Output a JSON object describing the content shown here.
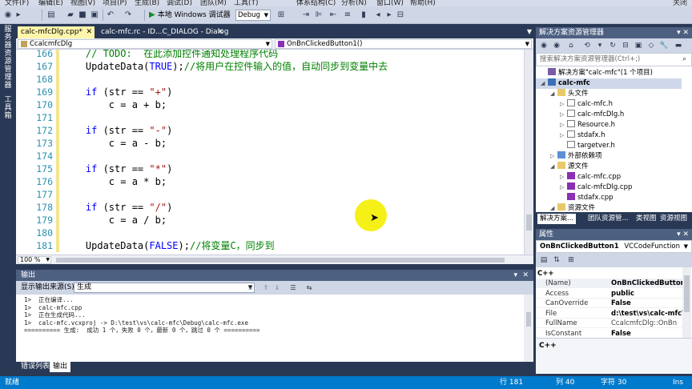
{
  "menubar": {
    "items": [
      "文件(F)",
      "编辑(E)",
      "视图(V)",
      "项目(P)",
      "生成(B)",
      "调试(D)",
      "团队(M)",
      "工具(T)",
      "体系结构(C)",
      "分析(N)",
      "窗口(W)",
      "帮助(H)"
    ],
    "close": "关闭"
  },
  "toolbar": {
    "run_label": "本地 Windows 调试器",
    "config_value": "Debug"
  },
  "left_rail": {
    "tab1": "服务器资源管理器",
    "tab2": "工具箱"
  },
  "doc_tabs": {
    "active_label": "calc-mfcDlg.cpp*",
    "inactive_label": "calc-mfc.rc - ID...C_DIALOG - Dialog"
  },
  "navbar": {
    "class_value": "CcalcmfcDlg",
    "member_value": "OnBnClickedButton1()"
  },
  "editor": {
    "lines": [
      {
        "num": "166",
        "tokens": [
          {
            "t": "    // TODO:  在此添加控件通知处理程序代码",
            "c": "cm"
          }
        ]
      },
      {
        "num": "167",
        "tokens": [
          {
            "t": "    UpdateData(",
            "c": ""
          },
          {
            "t": "TRUE",
            "c": "kw"
          },
          {
            "t": ");",
            "c": ""
          },
          {
            "t": "//将用户在控件输入的值，自动同步到变量中去",
            "c": "cm"
          }
        ]
      },
      {
        "num": "168",
        "tokens": []
      },
      {
        "num": "169",
        "tokens": [
          {
            "t": "    ",
            "c": ""
          },
          {
            "t": "if",
            "c": "kw"
          },
          {
            "t": " (str == ",
            "c": ""
          },
          {
            "t": "\"+\"",
            "c": "str"
          },
          {
            "t": ")",
            "c": ""
          }
        ]
      },
      {
        "num": "170",
        "tokens": [
          {
            "t": "        c = a + b;",
            "c": ""
          }
        ]
      },
      {
        "num": "171",
        "tokens": []
      },
      {
        "num": "172",
        "tokens": [
          {
            "t": "    ",
            "c": ""
          },
          {
            "t": "if",
            "c": "kw"
          },
          {
            "t": " (str == ",
            "c": ""
          },
          {
            "t": "\"-\"",
            "c": "str"
          },
          {
            "t": ")",
            "c": ""
          }
        ]
      },
      {
        "num": "173",
        "tokens": [
          {
            "t": "        c = a - b;",
            "c": ""
          }
        ]
      },
      {
        "num": "174",
        "tokens": []
      },
      {
        "num": "175",
        "tokens": [
          {
            "t": "    ",
            "c": ""
          },
          {
            "t": "if",
            "c": "kw"
          },
          {
            "t": " (str == ",
            "c": ""
          },
          {
            "t": "\"*\"",
            "c": "str"
          },
          {
            "t": ")",
            "c": ""
          }
        ]
      },
      {
        "num": "176",
        "tokens": [
          {
            "t": "        c = a * b;",
            "c": ""
          }
        ]
      },
      {
        "num": "177",
        "tokens": []
      },
      {
        "num": "178",
        "tokens": [
          {
            "t": "    ",
            "c": ""
          },
          {
            "t": "if",
            "c": "kw"
          },
          {
            "t": " (str == ",
            "c": ""
          },
          {
            "t": "\"/\"",
            "c": "str"
          },
          {
            "t": ")",
            "c": ""
          }
        ]
      },
      {
        "num": "179",
        "tokens": [
          {
            "t": "        c = a / b;",
            "c": ""
          }
        ]
      },
      {
        "num": "180",
        "tokens": []
      },
      {
        "num": "181",
        "tokens": [
          {
            "t": "    UpdateData(",
            "c": ""
          },
          {
            "t": "FALSE",
            "c": "kw"
          },
          {
            "t": ");",
            "c": ""
          },
          {
            "t": "//将变量C，同步到",
            "c": "cm"
          }
        ]
      }
    ],
    "zoom": "100 %"
  },
  "output": {
    "title": "输出",
    "source_label": "显示输出来源(S):",
    "source_value": "生成",
    "lines": [
      "1>  正在编译...",
      "1>  calc-mfc.cpp",
      "1>  正在生成代码...",
      "1>  calc-mfc.vcxproj -> D:\\test\\vs\\calc-mfc\\Debug\\calc-mfc.exe",
      "========== 生成:  成功 1 个，失败 0 个，最新 0 个，跳过 0 个 =========="
    ]
  },
  "bottom_tabs": {
    "errors": "错误列表",
    "output": "输出"
  },
  "solution_explorer": {
    "title": "解决方案资源管理器",
    "search_placeholder": "搜索解决方案资源管理器(Ctrl+;)",
    "tree": [
      {
        "label": "解决方案\"calc-mfc\"(1 个项目)",
        "icon": "solution-icon",
        "expander": "",
        "indent": 0,
        "bold": false
      },
      {
        "label": "calc-mfc",
        "icon": "project-icon",
        "expander": "◢",
        "indent": 0,
        "bold": true,
        "selected": true
      },
      {
        "label": "头文件",
        "icon": "folder-icon",
        "expander": "◢",
        "indent": 1,
        "bold": false
      },
      {
        "label": "calc-mfc.h",
        "icon": "file-icon",
        "expander": "▷",
        "indent": 2,
        "bold": false
      },
      {
        "label": "calc-mfcDlg.h",
        "icon": "file-icon",
        "expander": "▷",
        "indent": 2,
        "bold": false
      },
      {
        "label": "Resource.h",
        "icon": "file-icon",
        "expander": "▷",
        "indent": 2,
        "bold": false
      },
      {
        "label": "stdafx.h",
        "icon": "file-icon",
        "expander": "▷",
        "indent": 2,
        "bold": false
      },
      {
        "label": "targetver.h",
        "icon": "file-icon",
        "expander": "",
        "indent": 2,
        "bold": false
      },
      {
        "label": "外部依赖项",
        "icon": "external-deps-icon",
        "expander": "▷",
        "indent": 1,
        "bold": false
      },
      {
        "label": "源文件",
        "icon": "folder-icon",
        "expander": "◢",
        "indent": 1,
        "bold": false
      },
      {
        "label": "calc-mfc.cpp",
        "icon": "cpp-file-icon",
        "expander": "▷",
        "indent": 2,
        "bold": false
      },
      {
        "label": "calc-mfcDlg.cpp",
        "icon": "cpp-file-icon",
        "expander": "▷",
        "indent": 2,
        "bold": false
      },
      {
        "label": "stdafx.cpp",
        "icon": "cpp-file-icon",
        "expander": "",
        "indent": 2,
        "bold": false
      },
      {
        "label": "资源文件",
        "icon": "folder-icon",
        "expander": "◢",
        "indent": 1,
        "bold": false
      }
    ],
    "tabs": [
      "解决方案...",
      "团队资源管...",
      "类视图",
      "资源视图"
    ]
  },
  "properties": {
    "title": "属性",
    "object_name": "OnBnClickedButton1",
    "object_type": "VCCodeFunction",
    "category": "C++",
    "rows": [
      {
        "key": "(Name)",
        "value": "OnBnClickedButton1",
        "bold": true
      },
      {
        "key": "Access",
        "value": "public",
        "bold": true
      },
      {
        "key": "CanOverride",
        "value": "False",
        "bold": true
      },
      {
        "key": "File",
        "value": "d:\\test\\vs\\calc-mfc\\",
        "bold": true
      },
      {
        "key": "FullName",
        "value": "CcalcmfcDlg::OnBn",
        "bold": false
      },
      {
        "key": "IsConstant",
        "value": "False",
        "bold": true
      }
    ],
    "description": "C++"
  },
  "statusbar": {
    "left": "就绪",
    "row": "行 181",
    "col": "列 40",
    "char": "字符 30",
    "mode": "Ins"
  },
  "colors": {
    "accent": "#007acc",
    "chrome": "#293955",
    "active_tab": "#fff6ab",
    "keyword": "#0000ff",
    "string": "#a31515",
    "comment": "#008000",
    "line_number": "#2b91af"
  }
}
